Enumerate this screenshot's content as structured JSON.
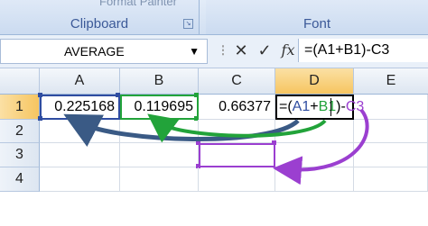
{
  "ribbon": {
    "group_clipboard": "Clipboard",
    "group_font": "Font",
    "faded_format_painter": "Format Painter"
  },
  "formula_bar": {
    "name_box": "AVERAGE",
    "cancel_symbol": "✕",
    "enter_symbol": "✓",
    "fx_symbol": "fx",
    "formula": "=(A1+B1)-C3"
  },
  "columns": [
    "A",
    "B",
    "C",
    "D",
    "E"
  ],
  "rows": [
    "1",
    "2",
    "3",
    "4"
  ],
  "cells": {
    "A1": "0.225168",
    "B1": "0.119695",
    "C1": "0.66377"
  },
  "edit_parts": {
    "open": "=(",
    "a1": "A1",
    "plus": "+",
    "b1": "B1",
    "close": ")-",
    "c3": "C3"
  },
  "colors": {
    "ref_a1": "#2f4da1",
    "ref_b1": "#22a33a",
    "ref_c3": "#9b3fd0",
    "active_row_col": "#f6c560"
  }
}
